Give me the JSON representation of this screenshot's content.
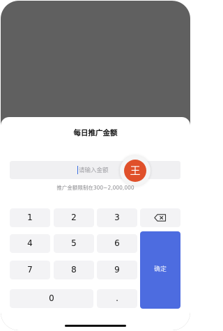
{
  "sheet": {
    "title": "每日推广金额",
    "input_placeholder": "请输入金额",
    "range_hint": "推广金额限制在300~2,000,000",
    "avatar_text": "王"
  },
  "keypad": {
    "keys": [
      "1",
      "2",
      "3",
      "4",
      "5",
      "6",
      "7",
      "8",
      "9",
      "0",
      "."
    ],
    "confirm_label": "确定",
    "delete_icon": "backspace-icon"
  },
  "colors": {
    "backdrop": "#606060",
    "confirm": "#4d6ce0",
    "avatar": "#e0502a",
    "key_background": "#f3f3f5"
  }
}
